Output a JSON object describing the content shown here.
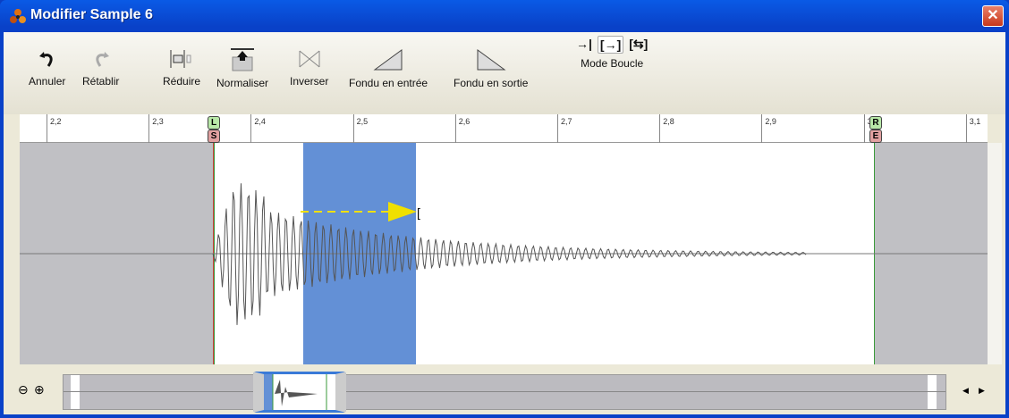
{
  "window": {
    "title": "Modifier Sample 6",
    "close_icon": "close-icon"
  },
  "toolbar": {
    "undo": "Annuler",
    "redo": "Rétablir",
    "trim": "Réduire",
    "normalize": "Normaliser",
    "reverse": "Inverser",
    "fade_in": "Fondu en entrée",
    "fade_out": "Fondu en sortie",
    "loop_mode": "Mode Boucle"
  },
  "ruler": {
    "ticks": [
      "2,2",
      "2,3",
      "2,4",
      "2,5",
      "2,6",
      "2,7",
      "2,8",
      "2,9",
      "3,0",
      "3,1"
    ],
    "markers": {
      "loop_start": "L",
      "sample_start": "S",
      "loop_end": "R",
      "sample_end": "E"
    }
  },
  "colors": {
    "selection": "#6390d6",
    "arrow": "#f0e000",
    "marker_green": "#3a9a3a",
    "marker_red": "#d04040"
  }
}
